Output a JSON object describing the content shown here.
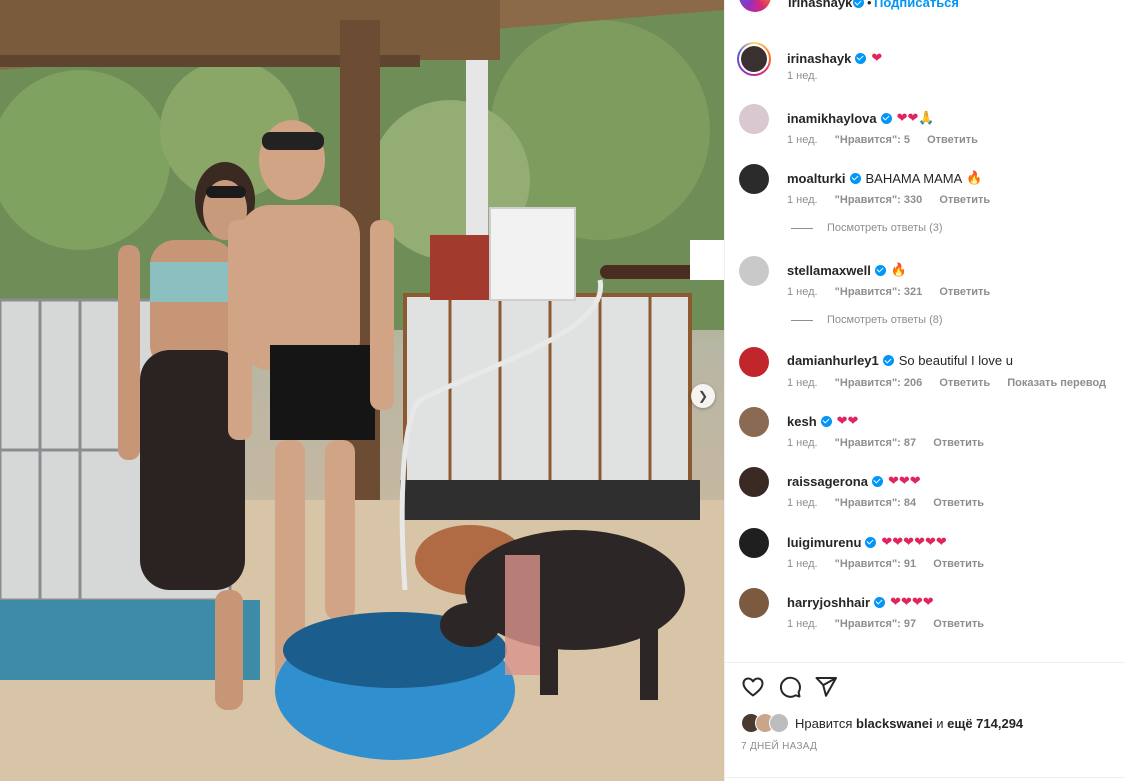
{
  "header": {
    "username": "irinashayk",
    "separator": "•",
    "follow_label": "Подписаться"
  },
  "caption": {
    "username": "irinashayk",
    "text": "",
    "hearts": "❤",
    "time": "1 нед."
  },
  "comments": [
    {
      "username": "inamikhaylova",
      "text": "",
      "emoji": "❤❤🙏",
      "time": "1 нед.",
      "likes": "\"Нравится\": 5",
      "reply": "Ответить",
      "avatar_color": "#d9c8d0"
    },
    {
      "username": "moalturki",
      "text": "BAHAMA MAMA",
      "emoji": "🔥",
      "time": "1 нед.",
      "likes": "\"Нравится\": 330",
      "reply": "Ответить",
      "avatar_color": "#2b2b2b",
      "view_replies": "Посмотреть ответы (3)"
    },
    {
      "username": "stellamaxwell",
      "text": "",
      "emoji": "🔥",
      "time": "1 нед.",
      "likes": "\"Нравится\": 321",
      "reply": "Ответить",
      "avatar_color": "#c9c9c9",
      "view_replies": "Посмотреть ответы (8)"
    },
    {
      "username": "damianhurley1",
      "text": "So beautiful I love u",
      "emoji": "",
      "time": "1 нед.",
      "likes": "\"Нравится\": 206",
      "reply": "Ответить",
      "translate": "Показать перевод",
      "avatar_color": "#c0262c"
    },
    {
      "username": "kesh",
      "text": "",
      "emoji": "❤❤",
      "time": "1 нед.",
      "likes": "\"Нравится\": 87",
      "reply": "Ответить",
      "avatar_color": "#8a6a52"
    },
    {
      "username": "raissagerona",
      "text": "",
      "emoji": "❤❤❤",
      "time": "1 нед.",
      "likes": "\"Нравится\": 84",
      "reply": "Ответить",
      "avatar_color": "#3b2a24"
    },
    {
      "username": "luigimurenu",
      "text": "",
      "emoji": "❤❤❤❤❤❤",
      "time": "1 нед.",
      "likes": "\"Нравится\": 91",
      "reply": "Ответить",
      "avatar_color": "#1f1f1f"
    },
    {
      "username": "harryjoshhair",
      "text": "",
      "emoji": "❤❤❤❤",
      "time": "1 нед.",
      "likes": "\"Нравится\": 97",
      "reply": "Ответить",
      "avatar_color": "#7b5a40"
    }
  ],
  "actions": {
    "like_icon": "heart-outline-icon",
    "comment_icon": "comment-bubble-icon",
    "share_icon": "paper-plane-icon"
  },
  "likes": {
    "prefix": "Нравится",
    "user": "blackswanei",
    "middle": "и",
    "count": "ещё 714,294"
  },
  "date": "7 ДНЕЙ НАЗАД",
  "colors": {
    "accent": "#0095f6",
    "heart": "#e0245e",
    "muted": "#8e8e8e"
  }
}
